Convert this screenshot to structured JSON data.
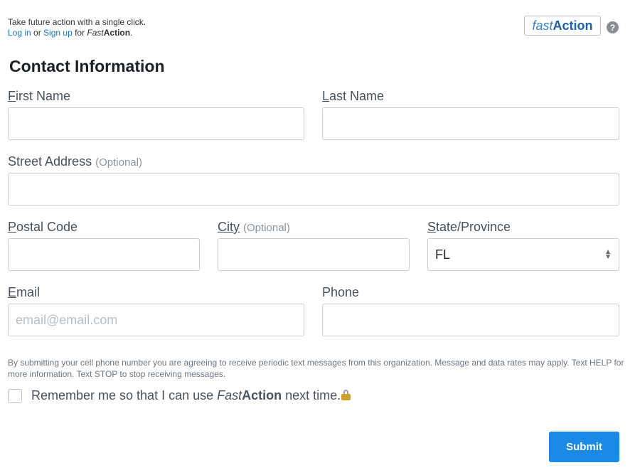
{
  "promo": {
    "line1": "Take future action with a single click.",
    "login_link": "Log in",
    "or_text": " or ",
    "signup_link": "Sign up",
    "for_text": " for ",
    "brand_italic": "Fast",
    "brand_bold": "Action",
    "period": "."
  },
  "logo": {
    "fast": "fast",
    "action": "Action"
  },
  "help": {
    "glyph": "?"
  },
  "section_title": "Contact Information",
  "fields": {
    "first_name": {
      "key": "F",
      "rest": "irst Name",
      "value": ""
    },
    "last_name": {
      "key": "L",
      "rest": "ast Name",
      "value": ""
    },
    "street": {
      "label": "Street Address",
      "optional": "(Optional)",
      "value": ""
    },
    "postal": {
      "key": "P",
      "rest": "ostal Code",
      "value": ""
    },
    "city": {
      "key": "City",
      "optional": "(Optional)",
      "value": ""
    },
    "state": {
      "key": "S",
      "rest": "tate/Province",
      "value": "FL"
    },
    "email": {
      "key": "E",
      "rest": "mail",
      "placeholder": "email@email.com"
    },
    "phone": {
      "label": "Phone",
      "value": ""
    }
  },
  "disclaimer": "By submitting your cell phone number you are agreeing to receive periodic text messages from this organization. Message and data rates may apply. Text HELP for more information. Text STOP to stop receiving messages.",
  "remember": {
    "prefix": "Remember me so that I can use ",
    "brand_italic": "Fast",
    "brand_bold": "Action",
    "suffix": " next time.",
    "checked": false
  },
  "submit_label": "Submit",
  "colors": {
    "accent": "#1b8ae6",
    "link": "#1a73c8",
    "border": "#c6ced6"
  },
  "icons": {
    "help": "help-icon",
    "lock": "lock-icon",
    "select": "chevron-up-down-icon"
  }
}
